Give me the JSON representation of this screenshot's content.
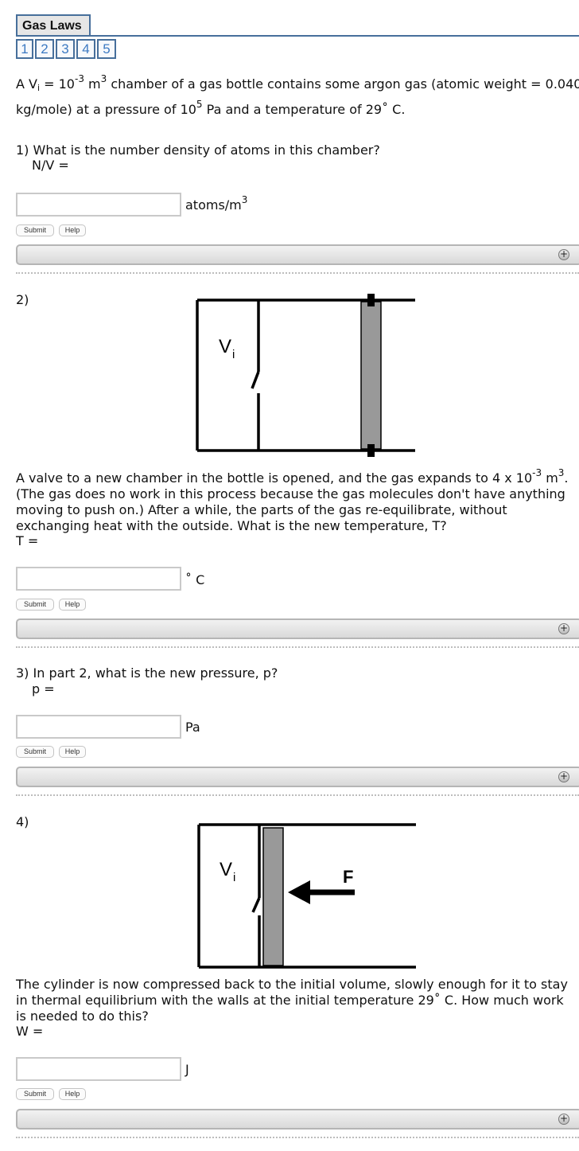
{
  "header": {
    "title": "Gas Laws",
    "pages": [
      "1",
      "2",
      "3",
      "4",
      "5"
    ]
  },
  "intro": {
    "line1_prefix": "A V",
    "line1_sub": "i",
    "line1_eq": " = 10",
    "line1_exp": "-3",
    "line1_unit": " m",
    "line1_unit_exp": "3",
    "line1_rest": " chamber of a gas bottle contains some argon gas (atomic weight = 0.040",
    "line2_prefix": "kg/mole) at a pressure of 10",
    "line2_exp": "5",
    "line2_rest": " Pa and a temperature of 29˚ C."
  },
  "questions": [
    {
      "number_text": "1) What is the number density of atoms in this chamber?",
      "prompt": "N/V =",
      "unit": "atoms/m",
      "unit_exp": "3",
      "value": "",
      "submit": "Submit",
      "help": "Help"
    },
    {
      "number_text": "2)",
      "figure_label": "V",
      "figure_label_sub": "i",
      "text_line1_prefix": "A valve to a new chamber in the bottle is opened, and the gas expands to 4 x 10",
      "text_line1_exp": "-3",
      "text_line1_unit": " m",
      "text_line1_unit_exp": "3",
      "text_line1_end": ".",
      "text_line2": "(The gas does no work in this process because the gas molecules don't have anything",
      "text_line3": "moving to push on.) After a while, the parts of the gas re-equilibrate, without",
      "text_line4": "exchanging heat with the outside. What is the new temperature, T?",
      "prompt": "T =",
      "unit": "˚ C",
      "value": "",
      "submit": "Submit",
      "help": "Help"
    },
    {
      "number_text": "3) In part 2, what is the new pressure, p?",
      "prompt": "p =",
      "unit": "Pa",
      "value": "",
      "submit": "Submit",
      "help": "Help"
    },
    {
      "number_text": "4)",
      "figure_label": "V",
      "figure_label_sub": "i",
      "force_label": "F",
      "text_line1": "The cylinder is now compressed back to the initial volume, slowly enough for it to stay",
      "text_line2": "in thermal equilibrium with the walls at the initial temperature 29˚ C. How much work",
      "text_line3": "is needed to do this?",
      "prompt": "W =",
      "unit": "J",
      "value": "",
      "submit": "Submit",
      "help": "Help"
    }
  ],
  "feedback_expand_symbol": "+",
  "colors": {
    "accent": "#476f9b",
    "nav_text": "#3d7ac2",
    "piston": "#999999"
  }
}
